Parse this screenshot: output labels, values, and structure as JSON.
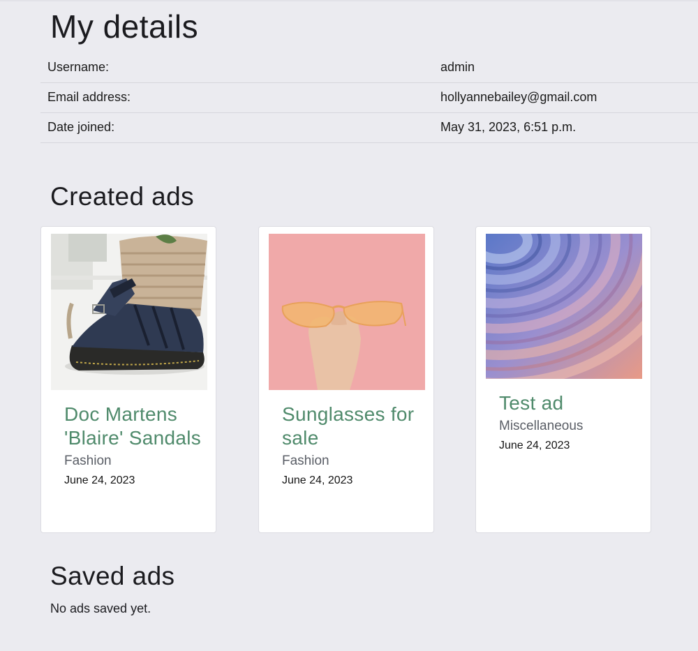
{
  "page_title": "My details",
  "details": [
    {
      "label": "Username:",
      "value": "admin"
    },
    {
      "label": "Email address:",
      "value": "hollyannebailey@gmail.com"
    },
    {
      "label": "Date joined:",
      "value": "May 31, 2023, 6:51 p.m."
    }
  ],
  "created_ads": {
    "title": "Created ads",
    "ads": [
      {
        "title": "Doc Martens 'Blaire' Sandals",
        "category": "Fashion",
        "date": "June 24, 2023",
        "image": "black-sandals-photo"
      },
      {
        "title": "Sunglasses for sale",
        "category": "Fashion",
        "date": "June 24, 2023",
        "image": "orange-sunglasses-photo"
      },
      {
        "title": "Test ad",
        "category": "Miscellaneous",
        "date": "June 24, 2023",
        "image": "abstract-ripple-photo"
      }
    ]
  },
  "saved_ads": {
    "title": "Saved ads",
    "empty_text": "No ads saved yet."
  },
  "colors": {
    "background": "#ebebf0",
    "ad_title": "#4f8a6b",
    "category": "#5a5e66"
  }
}
